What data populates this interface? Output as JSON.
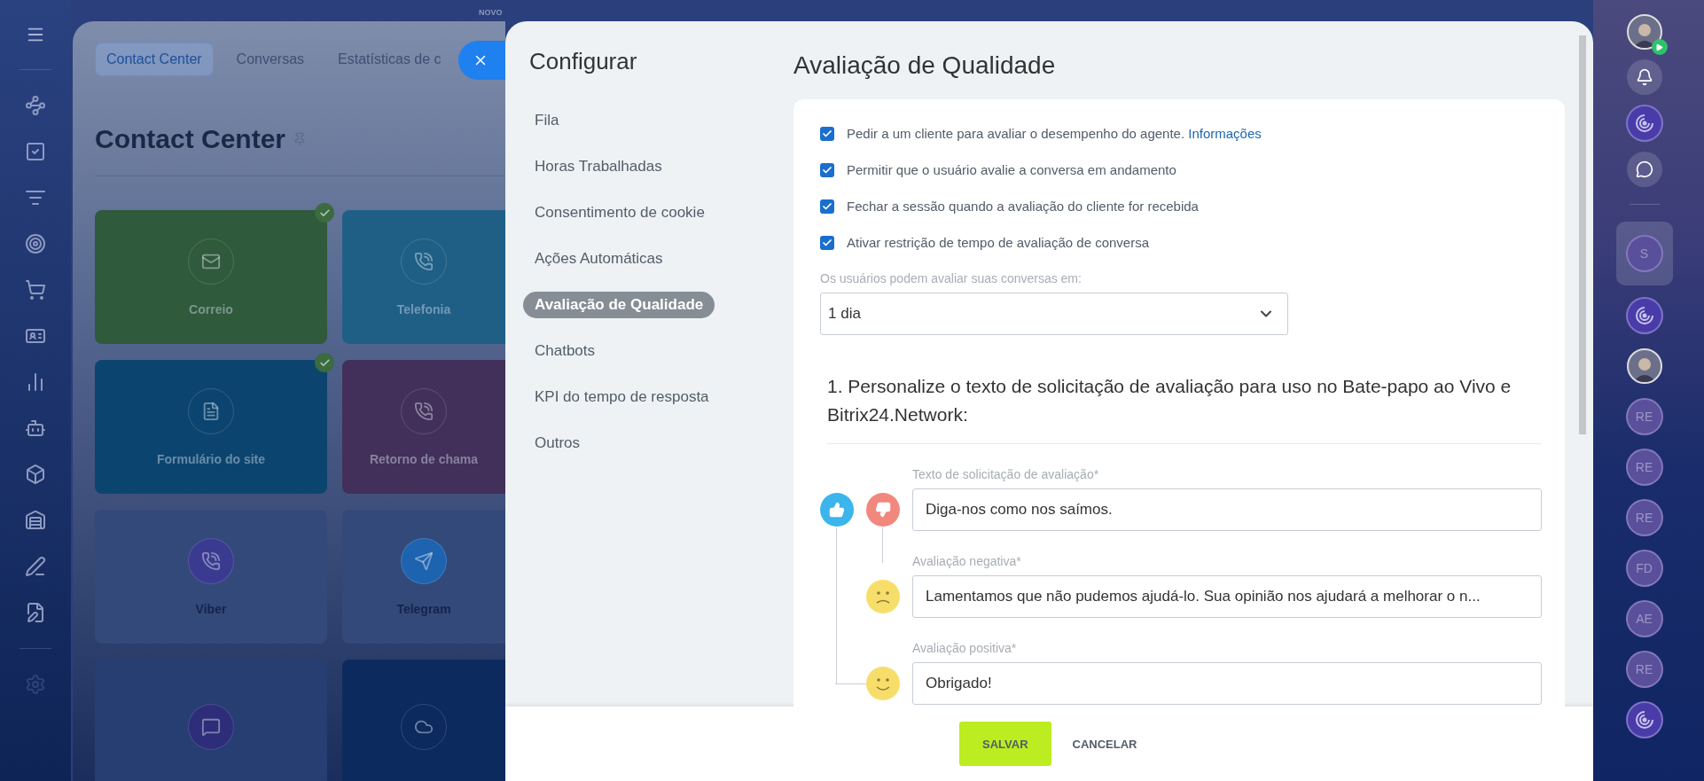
{
  "background_page": {
    "badge": "NOVO",
    "tabs": [
      {
        "label": "Contact Center",
        "selected": true
      },
      {
        "label": "Conversas",
        "selected": false
      },
      {
        "label": "Estatísticas de c",
        "selected": false
      }
    ],
    "title": "Contact Center",
    "tiles": [
      {
        "label": "Correio",
        "color": "#2f5a3c",
        "checked": true
      },
      {
        "label": "Telefonia",
        "color": "#1f5f86",
        "checked": false
      },
      {
        "label": "Formulário do site",
        "color": "#0b456f",
        "checked": true
      },
      {
        "label": "Retorno de chama",
        "color": "#42305a",
        "checked": false
      },
      {
        "label": "Viber",
        "color": "#33497a",
        "checked": false
      },
      {
        "label": "Telegram",
        "color": "#33497a",
        "checked": false
      },
      {
        "color": "#263e72",
        "checked": false
      },
      {
        "color": "#0c2a5e",
        "checked": false
      }
    ]
  },
  "modal": {
    "menu": {
      "title": "Configurar",
      "items": [
        {
          "label": "Fila",
          "selected": false
        },
        {
          "label": "Horas Trabalhadas",
          "selected": false
        },
        {
          "label": "Consentimento de cookie",
          "selected": false
        },
        {
          "label": "Ações Automáticas",
          "selected": false
        },
        {
          "label": "Avaliação de Qualidade",
          "selected": true
        },
        {
          "label": "Chatbots",
          "selected": false
        },
        {
          "label": "KPI do tempo de resposta",
          "selected": false
        },
        {
          "label": "Outros",
          "selected": false
        }
      ]
    },
    "title": "Avaliação de Qualidade",
    "options": [
      {
        "label": "Pedir a um cliente para avaliar o desempenho do agente.",
        "link": "Informações",
        "checked": true
      },
      {
        "label": "Permitir que o usuário avalie a conversa em andamento",
        "checked": true
      },
      {
        "label": "Fechar a sessão quando a avaliação do cliente for recebida",
        "checked": true
      },
      {
        "label": "Ativar restrição de tempo de avaliação de conversa",
        "checked": true
      }
    ],
    "period": {
      "label": "Os usuários podem avaliar suas conversas em:",
      "value": "1 dia"
    },
    "section_heading": "1. Personalize o texto de solicitação de avaliação para uso no Bate-papo ao Vivo e Bitrix24.Network:",
    "rating_fields": [
      {
        "kind": "request",
        "label": "Texto de solicitação de avaliação*",
        "value": "Diga-nos como nos saímos."
      },
      {
        "kind": "negative",
        "label": "Avaliação negativa*",
        "value": "Lamentamos que não pudemos ajudá-lo. Sua opinião nos ajudará a melhorar o n..."
      },
      {
        "kind": "positive",
        "label": "Avaliação positiva*",
        "value": "Obrigado!"
      }
    ],
    "buttons": [
      {
        "kind": "primary",
        "label": "SALVAR"
      },
      {
        "kind": "secondary",
        "label": "CANCELAR"
      }
    ]
  },
  "right_bar": {
    "tools": [
      {
        "kind": "user"
      },
      {
        "kind": "bell"
      },
      {
        "kind": "swirl"
      },
      {
        "kind": "chat"
      }
    ],
    "chats": [
      {
        "kind": "initials",
        "text": "S",
        "selected": true
      },
      {
        "kind": "swirl",
        "selected": false
      },
      {
        "kind": "user",
        "selected": false
      },
      {
        "kind": "initials",
        "text": "RE",
        "selected": false
      },
      {
        "kind": "initials",
        "text": "RE",
        "selected": false
      },
      {
        "kind": "initials",
        "text": "RE",
        "selected": false
      },
      {
        "kind": "initials",
        "text": "FD",
        "selected": false
      },
      {
        "kind": "initials",
        "text": "AE",
        "selected": false
      },
      {
        "kind": "initials",
        "text": "RE",
        "selected": false
      },
      {
        "kind": "swirl",
        "selected": false
      }
    ]
  }
}
